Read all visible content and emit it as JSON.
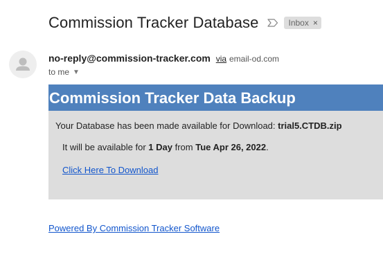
{
  "header": {
    "subject": "Commission Tracker Database",
    "important_icon": "important-marker-icon",
    "label": "Inbox",
    "label_close": "×"
  },
  "sender": {
    "avatar_icon": "person-icon",
    "email": "no-reply@commission-tracker.com",
    "via_label": "via",
    "via_domain": "email-od.com",
    "recipient_text": "to me",
    "recipient_caret": "▼"
  },
  "body": {
    "banner_title": "Commission Tracker Data Backup",
    "line1_prefix": "Your Database has been made available for Download: ",
    "line1_file": "trial5.CTDB.zip",
    "line2_prefix": "It will be available for ",
    "line2_duration": "1 Day",
    "line2_middle": " from ",
    "line2_date": "Tue Apr 26, 2022",
    "line2_suffix": ".",
    "download_link": "Click Here To Download"
  },
  "footer": {
    "link": "Powered By Commission Tracker Software"
  },
  "colors": {
    "banner": "#4f81bd",
    "panel": "#dddddd",
    "link": "#1155cc"
  }
}
